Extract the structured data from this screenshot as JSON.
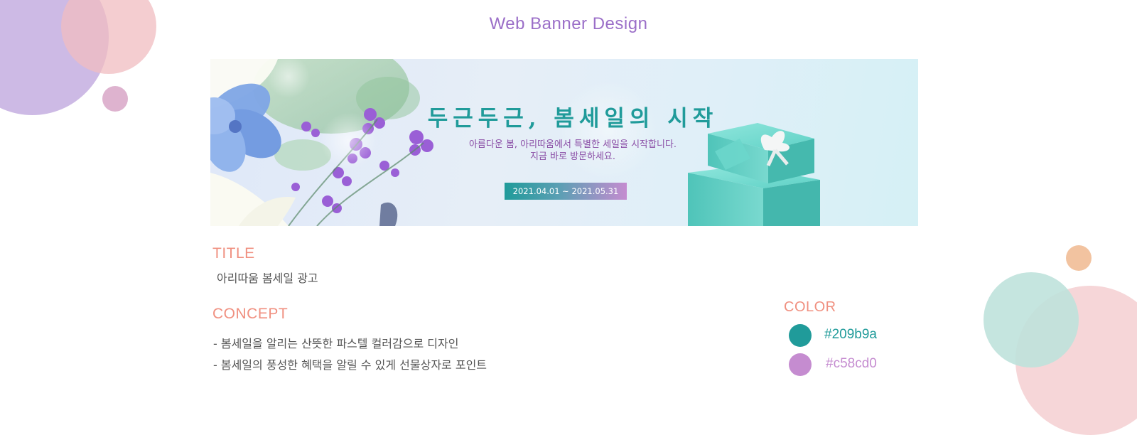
{
  "page": {
    "title": "Web Banner Design"
  },
  "banner": {
    "headline": "두근두근, 봄세일의 시작",
    "subtitle_line1": "아름다운 봄, 아리따움에서 특별한 세일을 시작합니다.",
    "subtitle_line2": "지금 바로 방문하세요.",
    "date_range": "2021.04.01 ~ 2021.05.31"
  },
  "title_section": {
    "label": "TITLE",
    "value": "아리따움 봄세일 광고"
  },
  "concept_section": {
    "label": "CONCEPT",
    "items": [
      "- 봄세일을 알리는 산뜻한 파스텔 컬러감으로 디자인",
      "- 봄세일의 풍성한 혜택을 알릴 수 있게 선물상자로 포인트"
    ]
  },
  "color_section": {
    "label": "COLOR",
    "colors": [
      {
        "hex": "#209b9a"
      },
      {
        "hex": "#c58cd0"
      }
    ]
  },
  "accent_colors": {
    "title": "#9b6fc8",
    "label": "#f09080",
    "teal": "#209b9a",
    "purple": "#c58cd0"
  }
}
